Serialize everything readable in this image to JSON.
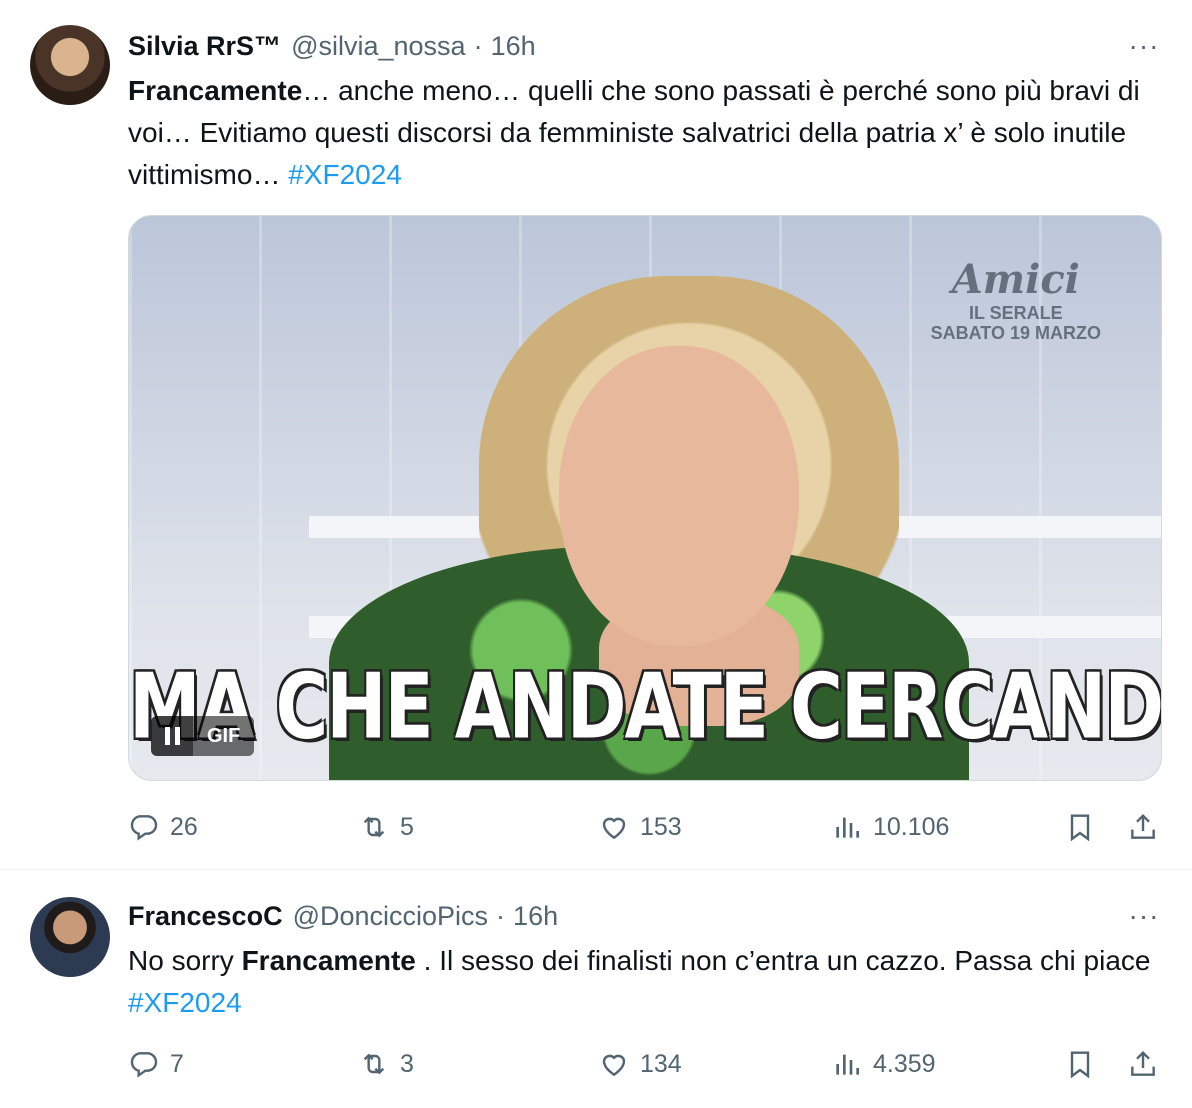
{
  "tweets": [
    {
      "display_name": "Silvia RrS™",
      "handle": "@silvia_nossa",
      "separator": "·",
      "time": "16h",
      "more_label": "···",
      "text_bold": "Francamente",
      "text_rest": "… anche meno… quelli che sono passati è perché sono più bravi di voi… Evitiamo questi discorsi da femministe salvatrici della patria x’ è solo inutile vittimismo… ",
      "hashtag": "#XF2024",
      "media": {
        "type": "GIF",
        "caption": "MA CHE ANDATE CERCANDO?",
        "logo_main": "Amici",
        "logo_line1": "IL SERALE",
        "logo_line2": "SABATO 19 MARZO",
        "badge": "GIF"
      },
      "stats": {
        "replies": "26",
        "reposts": "5",
        "likes": "153",
        "views": "10.106"
      }
    },
    {
      "display_name": "FrancescoC",
      "handle": "@DonciccioPics",
      "separator": "·",
      "time": "16h",
      "more_label": "···",
      "text_before": "No sorry ",
      "text_bold": "Francamente",
      "text_rest": " . Il sesso dei finalisti non c’entra un cazzo. Passa chi piace  ",
      "hashtag": "#XF2024",
      "stats": {
        "replies": "7",
        "reposts": "3",
        "likes": "134",
        "views": "4.359"
      }
    }
  ],
  "colors": {
    "text": "#0f1419",
    "secondary": "#536471",
    "link": "#1d9bf0",
    "border": "#eff3f4"
  }
}
